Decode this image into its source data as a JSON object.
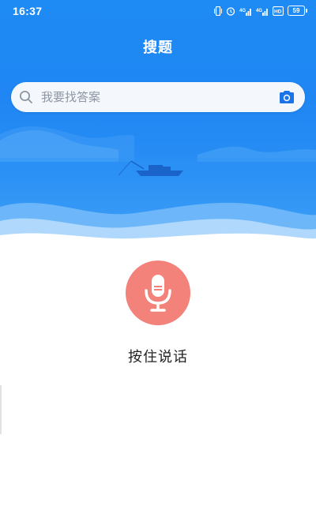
{
  "status_bar": {
    "time": "16:37",
    "battery": "59"
  },
  "header": {
    "title": "搜题"
  },
  "search": {
    "placeholder": "我要找答案"
  },
  "voice": {
    "label": "按住说话"
  },
  "colors": {
    "primary_blue": "#1e8af3",
    "mic_button": "#f2827a",
    "search_bg": "#f4f7fb",
    "placeholder_text": "#8d96a3",
    "camera_icon": "#1a73e8"
  },
  "icons": {
    "search": "search-icon",
    "camera": "camera-icon",
    "microphone": "microphone-icon"
  }
}
